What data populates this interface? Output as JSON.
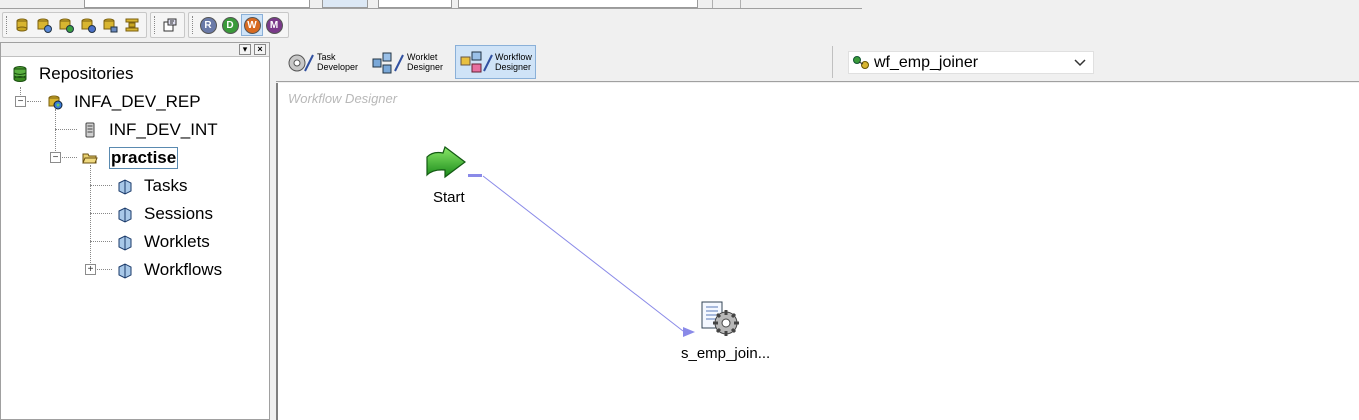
{
  "toolbar": {
    "repo_buttons": [
      "repository-connect-icon",
      "repository-add-icon",
      "repository-disconnect-icon",
      "repository-refresh-icon",
      "repository-user-icon",
      "repository-merge-icon"
    ],
    "extra_button": "properties-icon",
    "client_buttons": [
      {
        "letter": "R",
        "color": "#6a7aa8"
      },
      {
        "letter": "D",
        "color": "#3a9a3a"
      },
      {
        "letter": "W",
        "color": "#d86a20"
      },
      {
        "letter": "M",
        "color": "#7a3a8a"
      }
    ]
  },
  "navigator": {
    "root": "Repositories",
    "repository": "INFA_DEV_REP",
    "integration_service": "INF_DEV_INT",
    "folder": "practise",
    "folder_items": [
      "Tasks",
      "Sessions",
      "Worklets",
      "Workflows"
    ]
  },
  "designer": {
    "tools": [
      {
        "line1": "Task",
        "line2": "Developer"
      },
      {
        "line1": "Worklet",
        "line2": "Designer"
      },
      {
        "line1": "Workflow",
        "line2": "Designer"
      }
    ],
    "active_tool": "Workflow Designer",
    "workflow_selected": "wf_emp_joiner",
    "canvas_title": "Workflow Designer",
    "nodes": {
      "start": "Start",
      "session": "s_emp_join..."
    }
  }
}
